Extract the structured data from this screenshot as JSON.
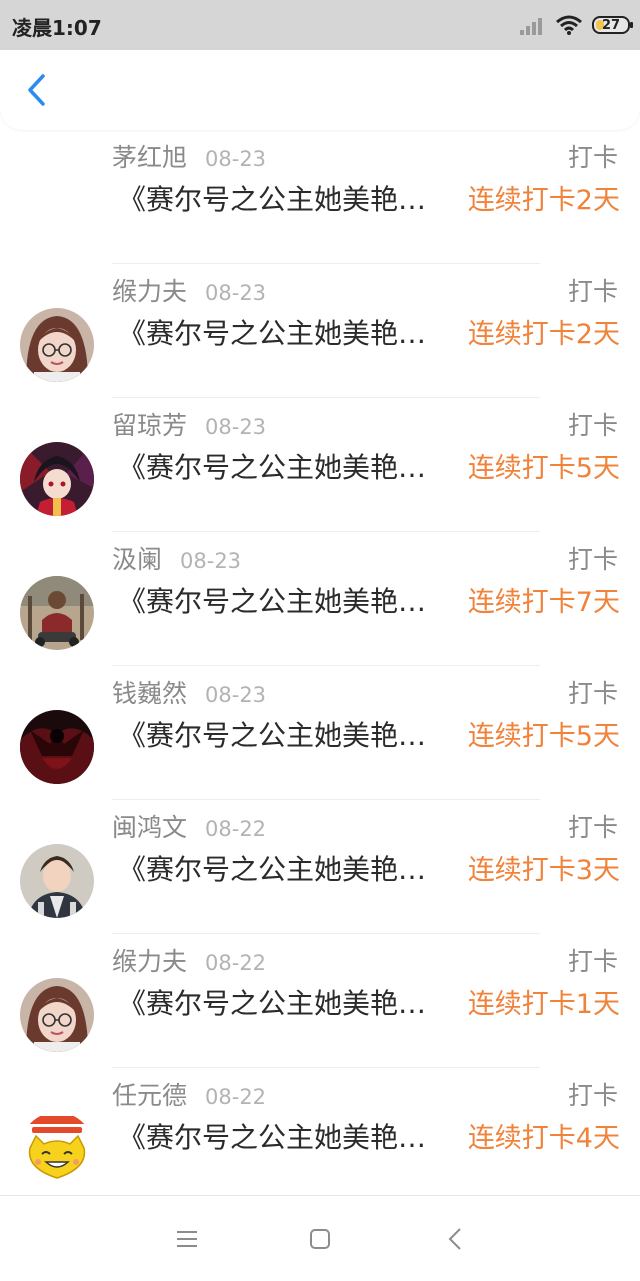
{
  "status_bar": {
    "time": "凌晨1:07",
    "battery": "27",
    "icons": [
      "signal-icon",
      "wifi-icon",
      "battery-icon"
    ]
  },
  "header": {
    "back_icon": "chevron-left-icon",
    "accent_color": "#2a8cf0"
  },
  "list": {
    "items": [
      {
        "name": "茅红旭",
        "date": "08-23",
        "label": "打卡",
        "title": "《赛尔号之公主她美艳…",
        "streak": "连续打卡2天",
        "avatar": "none"
      },
      {
        "name": "缑力夫",
        "date": "08-23",
        "label": "打卡",
        "title": "《赛尔号之公主她美艳…",
        "streak": "连续打卡2天",
        "avatar": "girl-glasses"
      },
      {
        "name": "留琼芳",
        "date": "08-23",
        "label": "打卡",
        "title": "《赛尔号之公主她美艳…",
        "streak": "连续打卡5天",
        "avatar": "anime-character"
      },
      {
        "name": "汲阑",
        "date": "08-23",
        "label": "打卡",
        "title": "《赛尔号之公主她美艳…",
        "streak": "连续打卡7天",
        "avatar": "person-outdoors"
      },
      {
        "name": "钱巍然",
        "date": "08-23",
        "label": "打卡",
        "title": "《赛尔号之公主她美艳…",
        "streak": "连续打卡5天",
        "avatar": "dark-figure"
      },
      {
        "name": "闽鸿文",
        "date": "08-22",
        "label": "打卡",
        "title": "《赛尔号之公主她美艳…",
        "streak": "连续打卡3天",
        "avatar": "young-man"
      },
      {
        "name": "缑力夫",
        "date": "08-22",
        "label": "打卡",
        "title": "《赛尔号之公主她美艳…",
        "streak": "连续打卡1天",
        "avatar": "girl-glasses"
      },
      {
        "name": "任元德",
        "date": "08-22",
        "label": "打卡",
        "title": "《赛尔号之公主她美艳…",
        "streak": "连续打卡4天",
        "avatar": "cartoon-face"
      }
    ]
  },
  "colors": {
    "streak": "#f0823a",
    "muted": "#8a8a8a",
    "text": "#2b2b2b"
  },
  "nav_bar": {
    "icons": [
      "menu-icon",
      "home-square-icon",
      "back-triangle-icon"
    ]
  }
}
